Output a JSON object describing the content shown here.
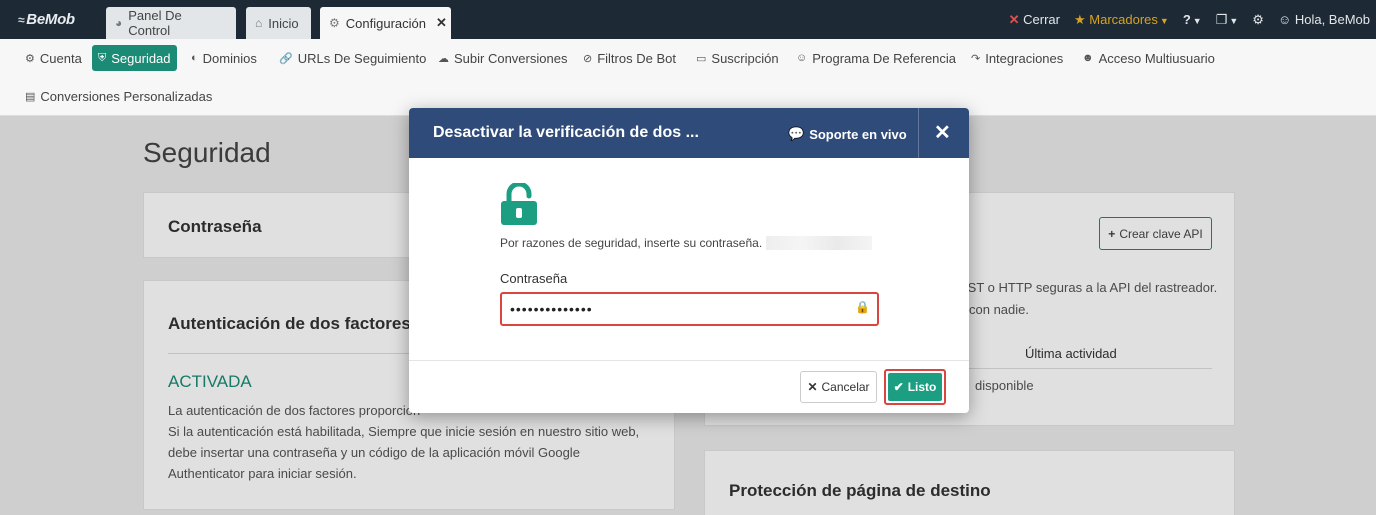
{
  "topbar": {
    "logo": "BeMob",
    "tabs": [
      {
        "label": "Panel De Control",
        "icon": "dashboard-icon"
      },
      {
        "label": "Inicio",
        "icon": "home-icon"
      },
      {
        "label": "Configuración",
        "icon": "gear-icon"
      }
    ],
    "close_label": "Cerrar",
    "bookmarks_label": "Marcadores",
    "greeting": "Hola, BeMob"
  },
  "subnav": {
    "items": [
      {
        "label": "Cuenta",
        "icon": "gear-icon"
      },
      {
        "label": "Seguridad",
        "icon": "shield-icon"
      },
      {
        "label": "Dominios",
        "icon": "globe-icon"
      },
      {
        "label": "URLs De Seguimiento",
        "icon": "link-icon"
      },
      {
        "label": "Subir Conversiones",
        "icon": "cloud-upload-icon"
      },
      {
        "label": "Filtros De Bot",
        "icon": "ban-icon"
      },
      {
        "label": "Suscripción",
        "icon": "credit-card-icon"
      },
      {
        "label": "Programa De Referencia",
        "icon": "users-icon"
      },
      {
        "label": "Integraciones",
        "icon": "plug-icon"
      },
      {
        "label": "Acceso Multiusuario",
        "icon": "user-group-icon"
      },
      {
        "label": "Conversiones Personalizadas",
        "icon": "file-icon"
      }
    ],
    "active": "Seguridad"
  },
  "page": {
    "title": "Seguridad",
    "password_card_title": "Contraseña",
    "twofa_title": "Autenticación de dos factores",
    "twofa_status": "ACTIVADA",
    "twofa_desc": [
      "La autenticación de dos factores proporcion",
      "Si la autenticación está habilitada, Siempre que inicie sesión en nuestro sitio web,",
      "debe insertar una contraseña y un código de la aplicación móvil Google",
      "Authenticator para iniciar sesión."
    ],
    "api_button": "Crear clave API",
    "api_desc": [
      "EST o HTTP seguras a la API del rastreador.",
      "con nadie."
    ],
    "api_last_activity": "Última actividad",
    "api_available": "disponible",
    "landing_title": "Protección de página de destino"
  },
  "modal": {
    "title": "Desactivar la verificación de dos ...",
    "support_label": "Soporte en vivo",
    "reason_text": "Por razones de seguridad, inserte su contraseña.",
    "password_label": "Contraseña",
    "password_value": "••••••••••••••",
    "cancel_label": "Cancelar",
    "done_label": "Listo"
  },
  "colors": {
    "topbar": "#1d2a35",
    "accent": "#1b8b76",
    "modal_header": "#2f4b7a",
    "error_outline": "#d9453f"
  }
}
